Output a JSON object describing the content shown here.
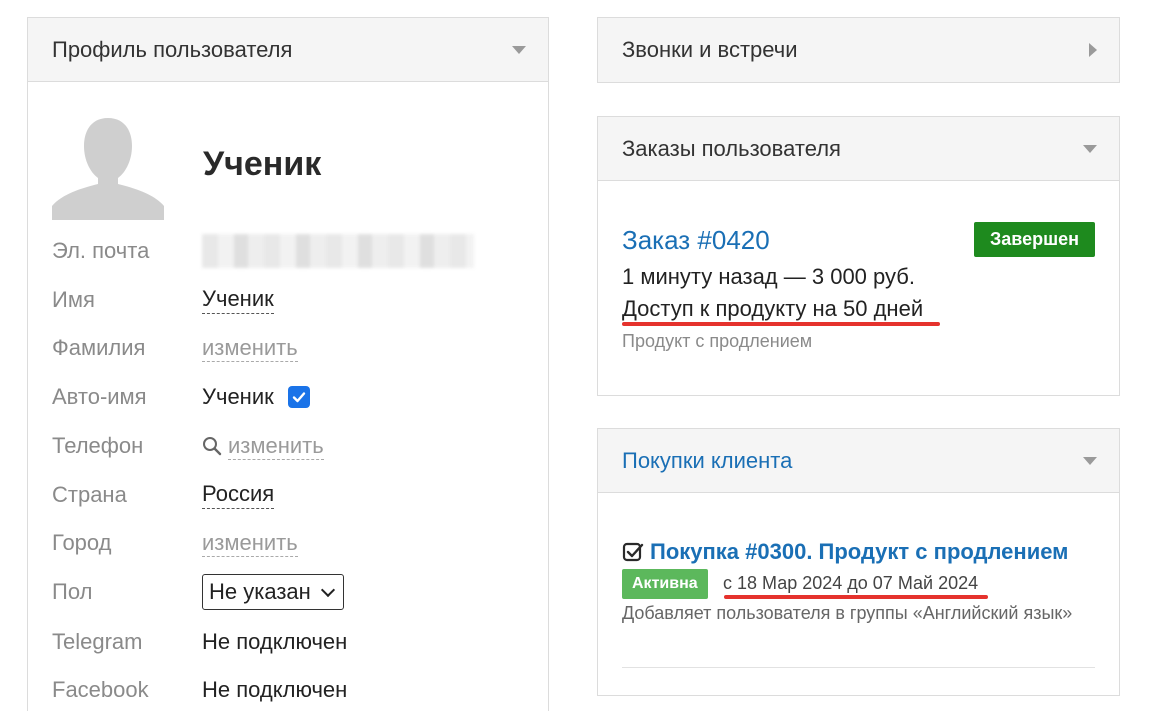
{
  "profile": {
    "header": "Профиль пользователя",
    "name": "Ученик",
    "rows": [
      {
        "label": "Эл. почта",
        "value": ""
      },
      {
        "label": "Имя",
        "value": "Ученик"
      },
      {
        "label": "Фамилия",
        "value": "изменить"
      },
      {
        "label": "Авто-имя",
        "value": "Ученик"
      },
      {
        "label": "Телефон",
        "value": "изменить"
      },
      {
        "label": "Страна",
        "value": "Россия"
      },
      {
        "label": "Город",
        "value": "изменить"
      },
      {
        "label": "Пол",
        "value": "Не указан"
      },
      {
        "label": "Telegram",
        "value": "Не подключен"
      },
      {
        "label": "Facebook",
        "value": "Не подключен"
      }
    ],
    "auto_name_checked": true
  },
  "calls": {
    "header": "Звонки и встречи"
  },
  "orders": {
    "header": "Заказы пользователя",
    "order_link": "Заказ #0420",
    "status": "Завершен",
    "meta": "1 минуту назад — 3 000 руб.",
    "access": "Доступ к продукту на 50 дней",
    "note": "Продукт с продлением"
  },
  "purchases": {
    "header": "Покупки клиента",
    "title": "Покупка #0300. Продукт с продлением",
    "status": "Активна",
    "dates": "с 18 Мар 2024 до 07 Май 2024",
    "description": "Добавляет пользователя в группы «Английский язык»"
  },
  "colors": {
    "link": "#1a6fb5",
    "badge_done": "#1e8a1e",
    "badge_active": "#5cb85c",
    "highlight_underline": "#e5322d"
  }
}
